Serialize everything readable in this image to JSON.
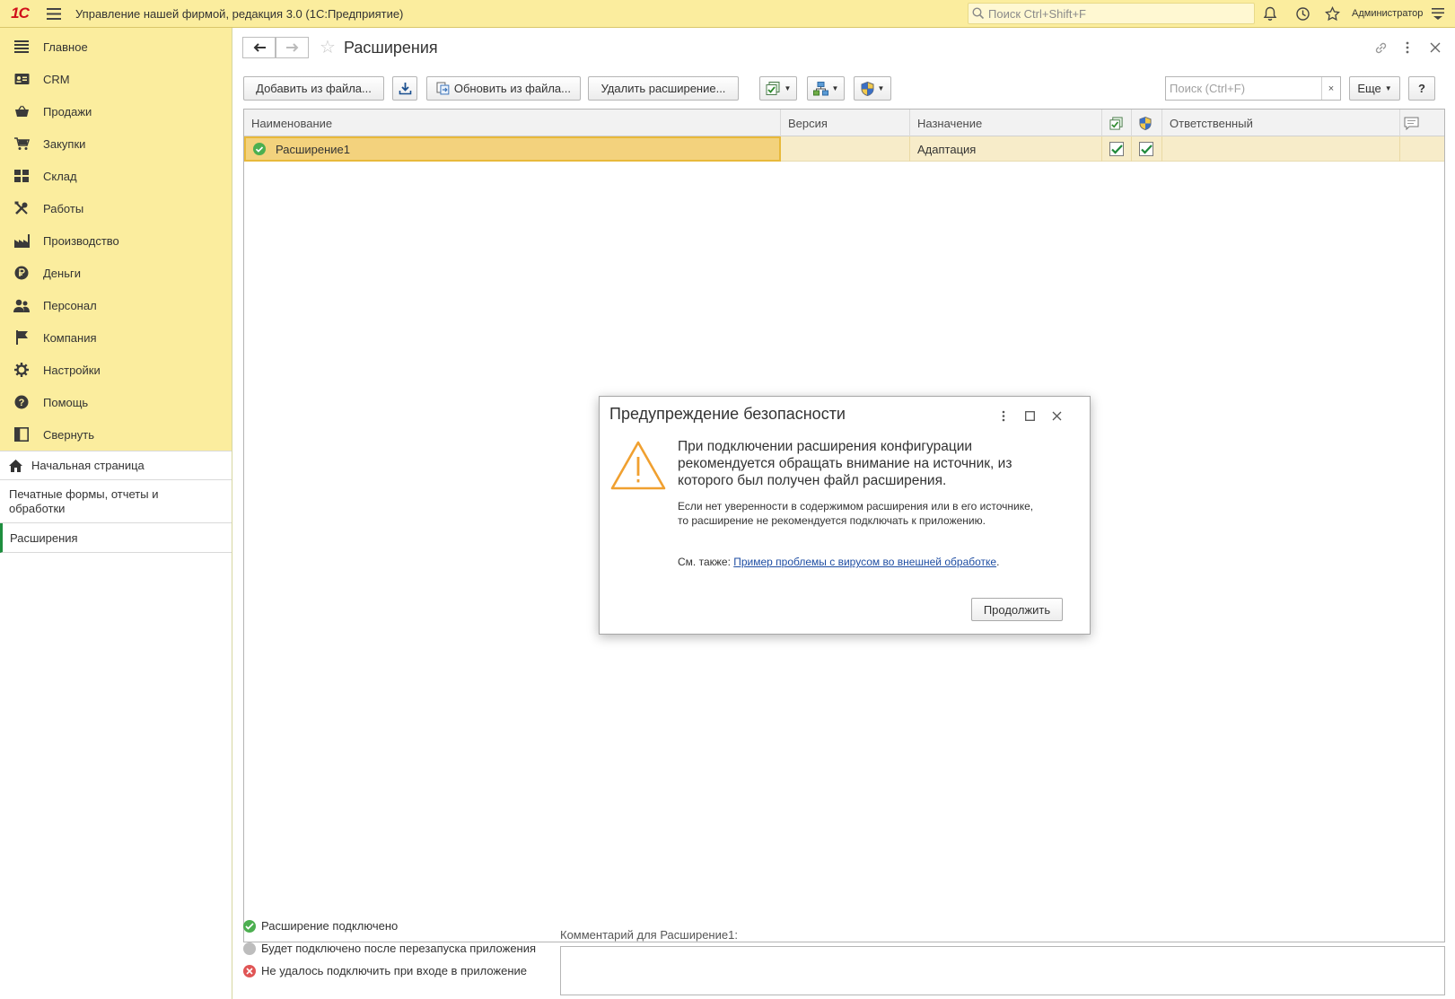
{
  "app": {
    "logo": "1С",
    "title": "Управление нашей фирмой, редакция 3.0  (1С:Предприятие)",
    "search_placeholder": "Поиск Ctrl+Shift+F",
    "user": "Администратор"
  },
  "sidebar": {
    "sections": [
      {
        "label": "Главное",
        "icon": "menu-lines-icon"
      },
      {
        "label": "CRM",
        "icon": "crm-card-icon"
      },
      {
        "label": "Продажи",
        "icon": "basket-icon"
      },
      {
        "label": "Закупки",
        "icon": "cart-icon"
      },
      {
        "label": "Склад",
        "icon": "warehouse-grid-icon"
      },
      {
        "label": "Работы",
        "icon": "tools-icon"
      },
      {
        "label": "Производство",
        "icon": "factory-icon"
      },
      {
        "label": "Деньги",
        "icon": "ruble-icon"
      },
      {
        "label": "Персонал",
        "icon": "people-icon"
      },
      {
        "label": "Компания",
        "icon": "flag-icon"
      },
      {
        "label": "Настройки",
        "icon": "gear-icon"
      },
      {
        "label": "Помощь",
        "icon": "help-icon"
      },
      {
        "label": "Свернуть",
        "icon": "collapse-icon"
      }
    ],
    "nav": {
      "home": "Начальная страница",
      "print_forms": "Печатные формы, отчеты и обработки",
      "extensions": "Расширения"
    }
  },
  "form": {
    "title": "Расширения",
    "toolbar": {
      "add_from_file": "Добавить из файла...",
      "update_from_file": "Обновить из файла...",
      "delete_extension": "Удалить расширение...",
      "search_placeholder": "Поиск (Ctrl+F)",
      "clear": "×",
      "more": "Еще",
      "help": "?"
    },
    "table": {
      "columns": [
        "Наименование",
        "Версия",
        "Назначение",
        "",
        "",
        "Ответственный",
        ""
      ],
      "rows": [
        {
          "name": "Расширение1",
          "version": "",
          "purpose": "Адаптация",
          "active": true,
          "safe_mode": true,
          "responsible": ""
        }
      ]
    },
    "legend": [
      {
        "label": "Расширение подключено",
        "color": "#4caf50"
      },
      {
        "label": "Будет подключено после перезапуска приложения",
        "color": "#bdbdbd"
      },
      {
        "label": "Не удалось подключить при входе в приложение",
        "color": "#e05555"
      }
    ],
    "comment_label": "Комментарий для Расширение1:"
  },
  "dialog": {
    "title": "Предупреждение безопасности",
    "main_text": "При подключении расширения конфигурации рекомендуется обращать внимание на источник, из которого был получен файл расширения.",
    "sub_text": "Если нет уверенности в содержимом расширения или в его источнике, то расширение не рекомендуется подключать к приложению.",
    "see_also_prefix": "См. также: ",
    "see_also_link": "Пример проблемы с вирусом во внешней обработке",
    "see_also_suffix": ".",
    "continue_button": "Продолжить",
    "warning_color": "#f0a030"
  },
  "colors": {
    "accent_yellow": "#fbed9e",
    "selection": "#f3d27d",
    "link": "#1f4ea3"
  }
}
